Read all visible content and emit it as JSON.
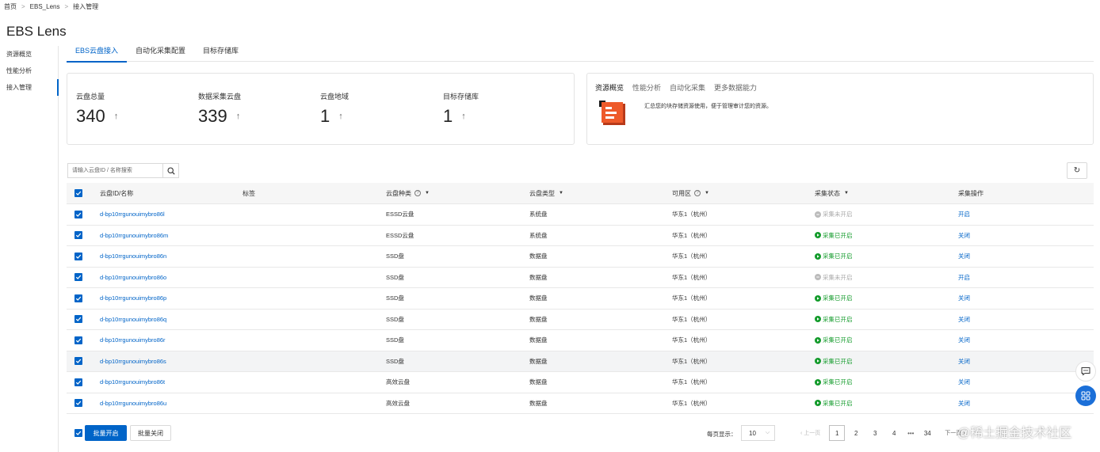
{
  "breadcrumb": [
    "首页",
    "EBS_Lens",
    "接入管理"
  ],
  "page_title": "EBS Lens",
  "sidebar": {
    "items": [
      {
        "label": "资源概览"
      },
      {
        "label": "性能分析"
      },
      {
        "label": "接入管理",
        "active": true
      }
    ]
  },
  "tabs": [
    {
      "label": "EBS云盘接入",
      "active": true
    },
    {
      "label": "自动化采集配置"
    },
    {
      "label": "目标存储库"
    }
  ],
  "stats": [
    {
      "label": "云盘总量",
      "value": "340"
    },
    {
      "label": "数据采集云盘",
      "value": "339"
    },
    {
      "label": "云盘地域",
      "value": "1"
    },
    {
      "label": "目标存储库",
      "value": "1"
    }
  ],
  "info_card": {
    "tabs": [
      "资源概览",
      "性能分析",
      "自动化采集",
      "更多数据能力"
    ],
    "description": "汇总您的块存储资源使用，便于管理审计您的资源。"
  },
  "search": {
    "placeholder": "请输入云盘ID / 名称搜索"
  },
  "table": {
    "headers": {
      "id": "云盘ID/名称",
      "tag": "标签",
      "category": "云盘种类",
      "type": "云盘类型",
      "zone": "可用区",
      "status": "采集状态",
      "action": "采集操作"
    },
    "rows": [
      {
        "id": "d-bp10rrgunouimybro86l",
        "category": "ESSD云盘",
        "type": "系统盘",
        "zone": "华东1（杭州）",
        "status": "采集未开启",
        "status_on": false,
        "action": "开启"
      },
      {
        "id": "d-bp10rrgunouimybro86m",
        "category": "ESSD云盘",
        "type": "系统盘",
        "zone": "华东1（杭州）",
        "status": "采集已开启",
        "status_on": true,
        "action": "关闭"
      },
      {
        "id": "d-bp10rrgunouimybro86n",
        "category": "SSD盘",
        "type": "数据盘",
        "zone": "华东1（杭州）",
        "status": "采集已开启",
        "status_on": true,
        "action": "关闭"
      },
      {
        "id": "d-bp10rrgunouimybro86o",
        "category": "SSD盘",
        "type": "数据盘",
        "zone": "华东1（杭州）",
        "status": "采集未开启",
        "status_on": false,
        "action": "开启"
      },
      {
        "id": "d-bp10rrgunouimybro86p",
        "category": "SSD盘",
        "type": "数据盘",
        "zone": "华东1（杭州）",
        "status": "采集已开启",
        "status_on": true,
        "action": "关闭"
      },
      {
        "id": "d-bp10rrgunouimybro86q",
        "category": "SSD盘",
        "type": "数据盘",
        "zone": "华东1（杭州）",
        "status": "采集已开启",
        "status_on": true,
        "action": "关闭"
      },
      {
        "id": "d-bp10rrgunouimybro86r",
        "category": "SSD盘",
        "type": "数据盘",
        "zone": "华东1（杭州）",
        "status": "采集已开启",
        "status_on": true,
        "action": "关闭"
      },
      {
        "id": "d-bp10rrgunouimybro86s",
        "category": "SSD盘",
        "type": "数据盘",
        "zone": "华东1（杭州）",
        "status": "采集已开启",
        "status_on": true,
        "action": "关闭"
      },
      {
        "id": "d-bp10rrgunouimybro86t",
        "category": "高效云盘",
        "type": "数据盘",
        "zone": "华东1（杭州）",
        "status": "采集已开启",
        "status_on": true,
        "action": "关闭"
      },
      {
        "id": "d-bp10rrgunouimybro86u",
        "category": "高效云盘",
        "type": "数据盘",
        "zone": "华东1（杭州）",
        "status": "采集已开启",
        "status_on": true,
        "action": "关闭"
      }
    ]
  },
  "footer": {
    "batch_enable": "批量开启",
    "batch_disable": "批量关闭",
    "page_size_label": "每页显示：",
    "page_size": "10",
    "prev": "上一页",
    "pages": [
      "1",
      "2",
      "3",
      "4"
    ],
    "ellipsis": "•••",
    "last_page": "34",
    "next": "下一页"
  },
  "watermark": "@稀土掘金技术社区",
  "colors": {
    "primary": "#0064c8",
    "success": "#139b2b",
    "muted": "#aaaaaa"
  }
}
